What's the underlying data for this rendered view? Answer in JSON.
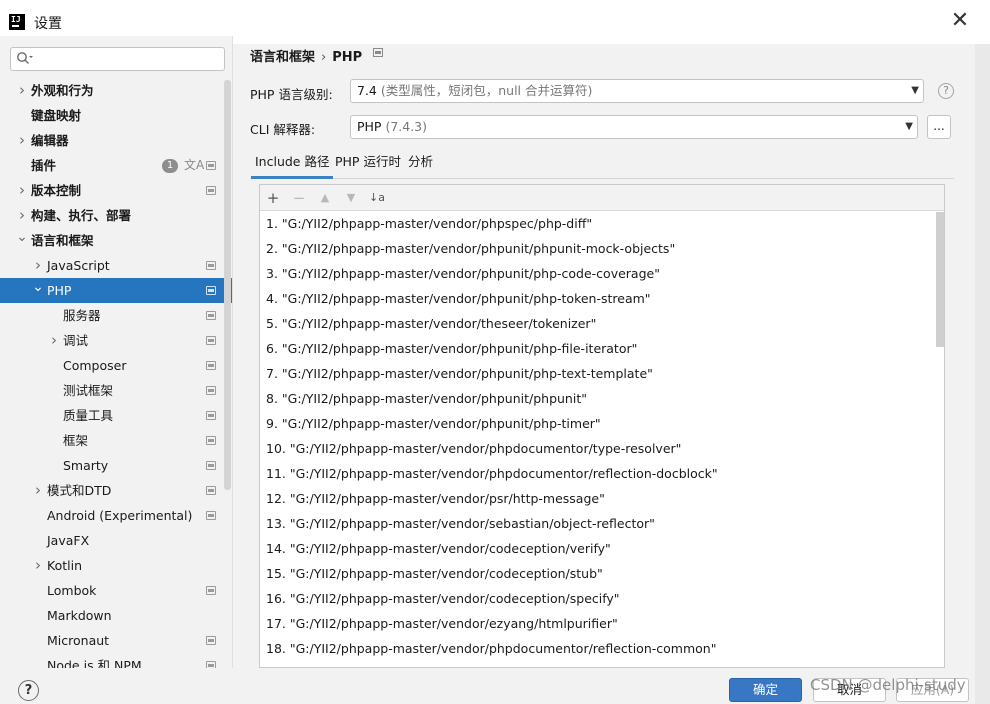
{
  "window": {
    "title": "设置",
    "close_glyph": "✕",
    "logo_text": "IJ"
  },
  "search": {
    "value": "",
    "placeholder": ""
  },
  "sidebar": {
    "items": [
      {
        "label": "外观和行为",
        "level": 0,
        "chevron": "right",
        "bold": true
      },
      {
        "label": "键盘映射",
        "level": 0,
        "bold": true
      },
      {
        "label": "编辑器",
        "level": 0,
        "chevron": "right",
        "bold": true
      },
      {
        "label": "插件",
        "level": 0,
        "bold": true,
        "badge": "1",
        "translate_icon": "文A",
        "project_icon": true
      },
      {
        "label": "版本控制",
        "level": 0,
        "chevron": "right",
        "bold": true,
        "project_icon": true
      },
      {
        "label": "构建、执行、部署",
        "level": 0,
        "chevron": "right",
        "bold": true
      },
      {
        "label": "语言和框架",
        "level": 0,
        "chevron": "down",
        "bold": true
      },
      {
        "label": "JavaScript",
        "level": 1,
        "chevron": "right",
        "project_icon": true
      },
      {
        "label": "PHP",
        "level": 1,
        "chevron": "down",
        "project_icon": true,
        "selected": true
      },
      {
        "label": "服务器",
        "level": 2,
        "project_icon": true
      },
      {
        "label": "调试",
        "level": 2,
        "chevron": "right",
        "project_icon": true
      },
      {
        "label": "Composer",
        "level": 2,
        "project_icon": true
      },
      {
        "label": "测试框架",
        "level": 2,
        "project_icon": true
      },
      {
        "label": "质量工具",
        "level": 2,
        "project_icon": true
      },
      {
        "label": "框架",
        "level": 2,
        "project_icon": true
      },
      {
        "label": "Smarty",
        "level": 2,
        "project_icon": true
      },
      {
        "label": "模式和DTD",
        "level": 1,
        "chevron": "right",
        "project_icon": true
      },
      {
        "label": "Android (Experimental)",
        "level": 1,
        "project_icon": true
      },
      {
        "label": "JavaFX",
        "level": 1
      },
      {
        "label": "Kotlin",
        "level": 1,
        "chevron": "right"
      },
      {
        "label": "Lombok",
        "level": 1,
        "project_icon": true
      },
      {
        "label": "Markdown",
        "level": 1
      },
      {
        "label": "Micronaut",
        "level": 1,
        "project_icon": true
      },
      {
        "label": "Node.js 和 NPM",
        "level": 1,
        "project_icon": true
      }
    ]
  },
  "breadcrumb": {
    "parent": "语言和框架",
    "separator": "›",
    "current": "PHP"
  },
  "settings": {
    "language_level_label": "PHP 语言级别:",
    "language_level_value": "7.4",
    "language_level_hint": " (类型属性，短闭包，null 合并运算符)",
    "cli_label": "CLI 解释器:",
    "cli_value": "PHP",
    "cli_hint": " (7.4.3)",
    "ellipsis": "...",
    "help": "?"
  },
  "tabs": [
    {
      "label": "Include 路径",
      "active": true
    },
    {
      "label": "PHP 运行时"
    },
    {
      "label": "分析"
    }
  ],
  "toolbar": {
    "add": "+",
    "remove": "−",
    "up": "▲",
    "down": "▼",
    "sort": "↓a"
  },
  "include_paths": [
    "1. \"G:/YII2/phpapp-master/vendor/phpspec/php-diff\"",
    "2. \"G:/YII2/phpapp-master/vendor/phpunit/phpunit-mock-objects\"",
    "3. \"G:/YII2/phpapp-master/vendor/phpunit/php-code-coverage\"",
    "4. \"G:/YII2/phpapp-master/vendor/phpunit/php-token-stream\"",
    "5. \"G:/YII2/phpapp-master/vendor/theseer/tokenizer\"",
    "6. \"G:/YII2/phpapp-master/vendor/phpunit/php-file-iterator\"",
    "7. \"G:/YII2/phpapp-master/vendor/phpunit/php-text-template\"",
    "8. \"G:/YII2/phpapp-master/vendor/phpunit/phpunit\"",
    "9. \"G:/YII2/phpapp-master/vendor/phpunit/php-timer\"",
    "10. \"G:/YII2/phpapp-master/vendor/phpdocumentor/type-resolver\"",
    "11. \"G:/YII2/phpapp-master/vendor/phpdocumentor/reflection-docblock\"",
    "12. \"G:/YII2/phpapp-master/vendor/psr/http-message\"",
    "13. \"G:/YII2/phpapp-master/vendor/sebastian/object-reflector\"",
    "14. \"G:/YII2/phpapp-master/vendor/codeception/verify\"",
    "15. \"G:/YII2/phpapp-master/vendor/codeception/stub\"",
    "16. \"G:/YII2/phpapp-master/vendor/codeception/specify\"",
    "17. \"G:/YII2/phpapp-master/vendor/ezyang/htmlpurifier\"",
    "18. \"G:/YII2/phpapp-master/vendor/phpdocumentor/reflection-common\""
  ],
  "footer": {
    "help": "?",
    "ok": "确定",
    "cancel": "取消",
    "apply": "应用(A)"
  },
  "watermark": "CSDN @delphi-study",
  "colors": {
    "selection": "#2675bf",
    "primary_button": "#3777c4",
    "tab_underline": "#3b82c4"
  }
}
